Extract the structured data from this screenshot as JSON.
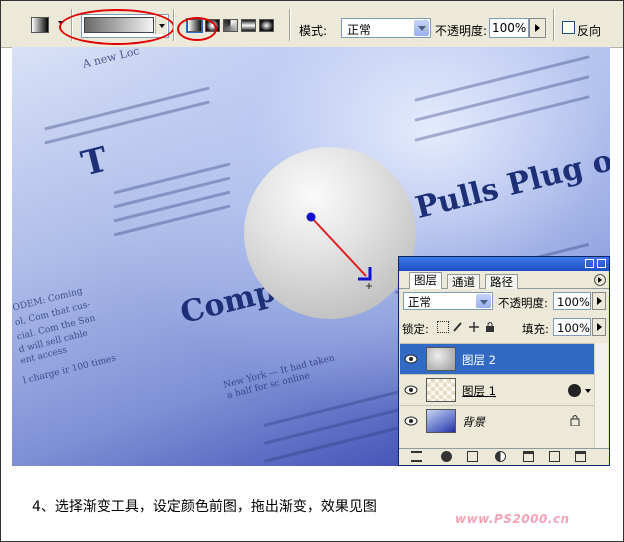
{
  "toolbar": {
    "mode_label": "模式:",
    "mode_value": "正常",
    "opacity_label": "不透明度:",
    "opacity_value": "100%",
    "reverse_label": "反向"
  },
  "newspaper": {
    "headline": "Compu",
    "headline2": "Pulls Plug on",
    "dropcap": "T",
    "text_lines": [
      "A new Loc",
      "ODEM: Coming",
      "ol, Com that cus-",
      "cial. Com the San",
      "d will sell cable",
      "ent access",
      "l charge ir 100 times",
      "New York — It had taken",
      "a half for sc online"
    ]
  },
  "layers_panel": {
    "tabs": [
      "图层",
      "通道",
      "路径"
    ],
    "blend_mode": "正常",
    "opacity_label": "不透明度:",
    "opacity_value": "100%",
    "lock_label": "锁定:",
    "fill_label": "填充:",
    "fill_value": "100%",
    "layers": [
      {
        "name": "图层 2",
        "selected": true
      },
      {
        "name": "图层 1",
        "selected": false
      },
      {
        "name": "背景",
        "selected": false
      }
    ]
  },
  "caption": "4、选择渐变工具，设定颜色前图，拖出渐变，效果见图",
  "watermark": "www.PS2000.cn",
  "colors": {
    "annotation_red": "#e00000",
    "selection_blue": "#316ac5",
    "gradient_line": "#e02020",
    "gradient_point": "#1010d0"
  }
}
